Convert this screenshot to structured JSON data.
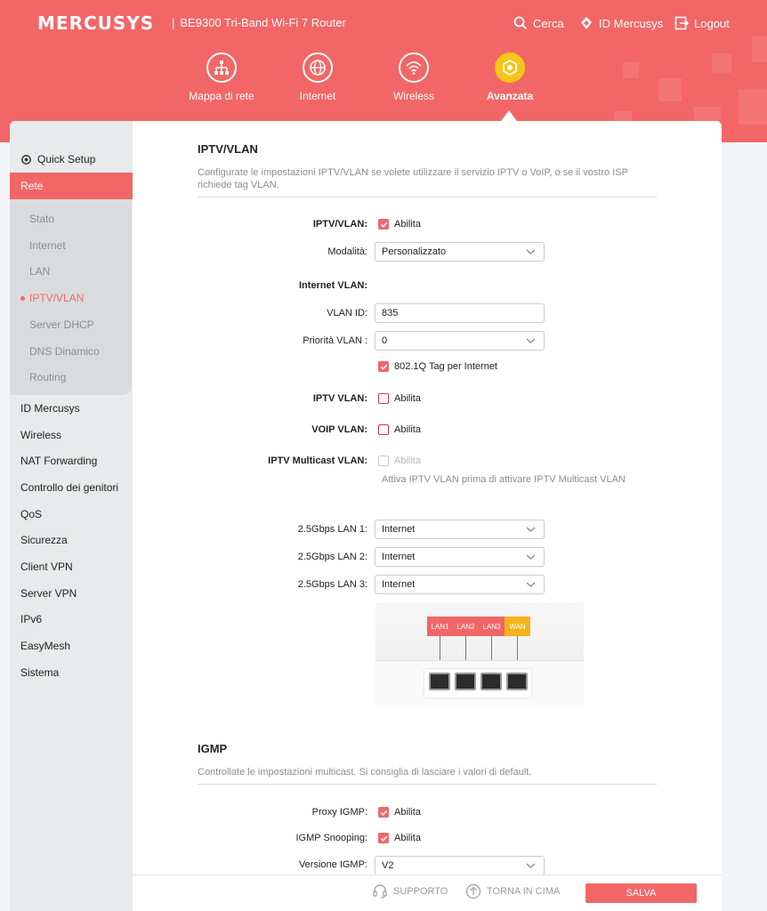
{
  "header": {
    "logo": "MERCUSYS",
    "separator": "|",
    "model": "BE9300 Tri-Band Wi-Fi 7 Router",
    "search": "Cerca",
    "account": "ID Mercusys",
    "logout": "Logout"
  },
  "nav": [
    {
      "label": "Mappa di rete",
      "icon": "network-map-icon"
    },
    {
      "label": "Internet",
      "icon": "globe-icon"
    },
    {
      "label": "Wireless",
      "icon": "wifi-icon"
    },
    {
      "label": "Avanzata",
      "icon": "gear-icon",
      "active": true
    }
  ],
  "sidebar": {
    "quick_setup": "Quick Setup",
    "rete": "Rete",
    "sub": [
      "Stato",
      "Internet",
      "LAN",
      "IPTV/VLAN",
      "Server DHCP",
      "DNS Dinamico",
      "Routing"
    ],
    "items": [
      "ID Mercusys",
      "Wireless",
      "NAT Forwarding",
      "Controllo dei genitori",
      "QoS",
      "Sicurezza",
      "Client VPN",
      "Server VPN",
      "IPv6",
      "EasyMesh",
      "Sistema"
    ]
  },
  "iptv": {
    "title": "IPTV/VLAN",
    "desc": "Configurate le impostazioni IPTV/VLAN se volete utilizzare il servizio IPTV o VoIP, o se il vostro ISP richiede tag VLAN.",
    "enable_label": "IPTV/VLAN:",
    "enable_text": "Abilita",
    "mode_label": "Modalità:",
    "mode_value": "Personalizzato",
    "internet_vlan_label": "Internet VLAN:",
    "vlan_id_label": "VLAN ID:",
    "vlan_id_value": "835",
    "priority_label": "Priorità VLAN :",
    "priority_value": "0",
    "tag_text": "802.1Q Tag per Internet",
    "iptv_vlan_label": "IPTV VLAN:",
    "iptv_vlan_text": "Abilita",
    "voip_vlan_label": "VOIP VLAN:",
    "voip_vlan_text": "Abilita",
    "multicast_label": "IPTV Multicast VLAN:",
    "multicast_text": "Abilita",
    "multicast_hint": "Attiva IPTV VLAN prima di attivare IPTV Multicast VLAN",
    "lan1_label": "2.5Gbps LAN 1:",
    "lan1_value": "Internet",
    "lan2_label": "2.5Gbps LAN 2:",
    "lan2_value": "Internet",
    "lan3_label": "2.5Gbps LAN 3:",
    "lan3_value": "Internet",
    "ports": [
      "LAN1",
      "LAN2",
      "LAN3",
      "WAN"
    ]
  },
  "igmp": {
    "title": "IGMP",
    "desc": "Controllate le impostazioni multicast. Si consiglia di lasciare i valori di default.",
    "proxy_label": "Proxy IGMP:",
    "proxy_text": "Abilita",
    "snooping_label": "IGMP Snooping:",
    "snooping_text": "Abilita",
    "version_label": "Versione IGMP:",
    "version_value": "V2"
  },
  "footer": {
    "support": "SUPPORTO",
    "top": "TORNA IN CIMA",
    "save": "SALVA"
  },
  "colors": {
    "brand": "#f26667",
    "accent_active": "#f5c518",
    "wan": "#f5b21b"
  }
}
